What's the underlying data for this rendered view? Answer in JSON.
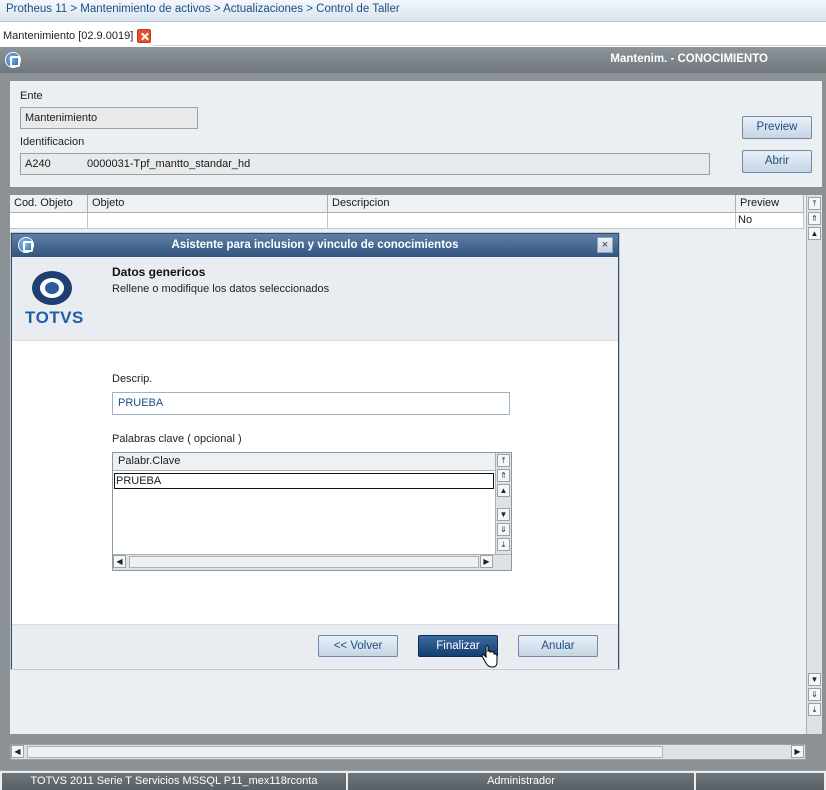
{
  "breadcrumb": "Protheus 11 > Mantenimiento de activos > Actualizaciones > Control de Taller",
  "tab": {
    "label": "Mantenimiento [02.9.0019]"
  },
  "main_window": {
    "title": "Mantenim. - CONOCIMIENTO",
    "ente_label": "Ente",
    "ente_value": "Mantenimiento",
    "identificacion_label": "Identificacion",
    "identificacion_code": "A240",
    "identificacion_value": "0000031-Tpf_mantto_standar_hd",
    "preview_button": "Preview",
    "abrir_button": "Abrir",
    "grid": {
      "columns": [
        "Cod. Objeto",
        "Objeto",
        "Descripcion",
        "Preview"
      ],
      "rows": [
        [
          "",
          "",
          "",
          "No"
        ]
      ]
    }
  },
  "status_bar": {
    "system": "TOTVS 2011 Serie T Servicios MSSQL P11_mex118rconta",
    "user": "Administrador"
  },
  "dialog": {
    "title": "Asistente para inclusion y vinculo de conocimientos",
    "close": "×",
    "logo_text": "TOTVS",
    "section_title": "Datos genericos",
    "section_subtitle": "Rellene o modifique los datos seleccionados",
    "descrip_label": "Descrip.",
    "descrip_value": "PRUEBA",
    "keywords_label": "Palabras clave ( opcional )",
    "keywords_column": "Palabr.Clave",
    "keywords": [
      "PRUEBA"
    ],
    "buttons": {
      "back": "<< Volver",
      "finish": "Finalizar",
      "cancel": "Anular"
    }
  },
  "colors": {
    "accent": "#1d4f86",
    "dialog_header": "#33557e",
    "primary_button": "#143e70"
  }
}
